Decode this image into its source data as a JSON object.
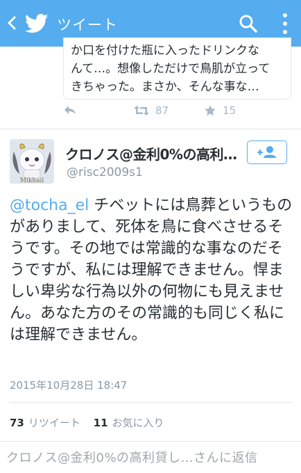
{
  "header": {
    "title": "ツイート",
    "color": "#55acee"
  },
  "quoted": {
    "text": "か口を付けた瓶に入ったドリンクな\nんて…。想像しただけで鳥肌が立って\nきちゃった。まさか、そんな事な…"
  },
  "quoted_actions": {
    "retweets": "87",
    "favorites": "15"
  },
  "tweet": {
    "avatar_label": "Mikhail",
    "display_name": "クロノス@金利0%の高利貸し",
    "handle": "@risc2009s1",
    "mention": "@tocha_el",
    "body": " チベットには鳥葬というものがありまして、死体を鳥に食べさせるそうです。その地では常識的な事なのだそうですが、私には理解できません。悍ましい卑劣な行為以外の何物にも見えません。あなた方のその常識的も同じく私には理解できません。",
    "date": "2015年10月28日 18:47",
    "retweet_count": "73",
    "retweet_label": "リツイート",
    "favorite_count": "11",
    "favorite_label": "お気に入り"
  },
  "reply_box": {
    "placeholder": "クロノス@金利0%の高利貸し…さんに返信"
  },
  "accent": "#55acee"
}
